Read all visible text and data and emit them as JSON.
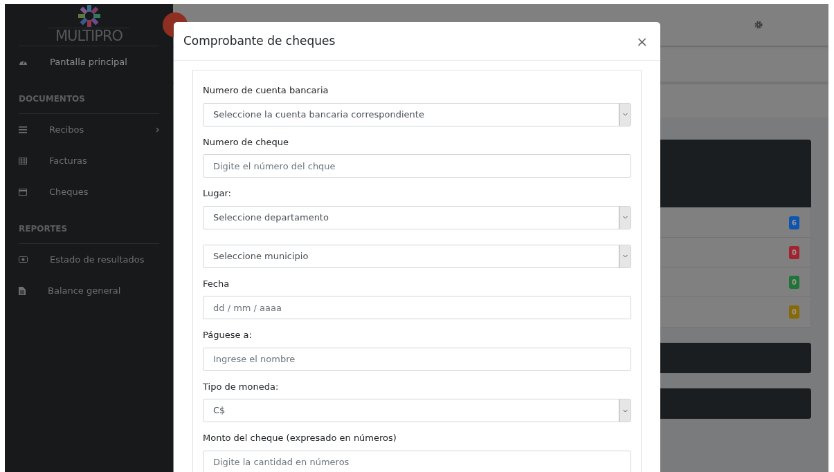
{
  "sidebar": {
    "brand": "MULTIPRO",
    "items": [
      {
        "kind": "link",
        "label": "Pantalla principal",
        "submenu": false
      },
      {
        "kind": "heading",
        "label": "DOCUMENTOS"
      },
      {
        "kind": "link",
        "label": "Recibos",
        "submenu": true
      },
      {
        "kind": "link",
        "label": "Facturas",
        "submenu": false
      },
      {
        "kind": "link",
        "label": "Cheques",
        "submenu": false
      },
      {
        "kind": "heading",
        "label": "REPORTES"
      },
      {
        "kind": "link",
        "label": "Estado de resultados",
        "submenu": false
      },
      {
        "kind": "link",
        "label": "Balance general",
        "submenu": false
      }
    ]
  },
  "status_list": [
    {
      "count": "6",
      "color": "#0d55b0"
    },
    {
      "count": "0",
      "color": "#a3232f"
    },
    {
      "count": "0",
      "color": "#1f7436"
    },
    {
      "count": "0",
      "color": "#866a05"
    }
  ],
  "modal": {
    "title": "Comprobante de cheques",
    "close": "×",
    "fields": [
      {
        "kind": "select",
        "label": "Numero de cuenta bancaria",
        "value": "Seleccione la cuenta bancaria correspondiente"
      },
      {
        "kind": "input",
        "label": "Numero de cheque",
        "placeholder": "Digite el número del chque"
      },
      {
        "kind": "select",
        "label": "Lugar:",
        "value": "Seleccione departamento"
      },
      {
        "kind": "select",
        "value": "Seleccione municipio"
      },
      {
        "kind": "input",
        "label": "Fecha",
        "placeholder": "dd / mm / aaaa"
      },
      {
        "kind": "input",
        "label": "Páguese a:",
        "placeholder": "Ingrese el nombre"
      },
      {
        "kind": "select",
        "label": "Tipo de moneda:",
        "value": "C$"
      },
      {
        "kind": "input",
        "label": "Monto del cheque (expresado en números)",
        "placeholder": "Digite la cantidad en números"
      }
    ]
  }
}
